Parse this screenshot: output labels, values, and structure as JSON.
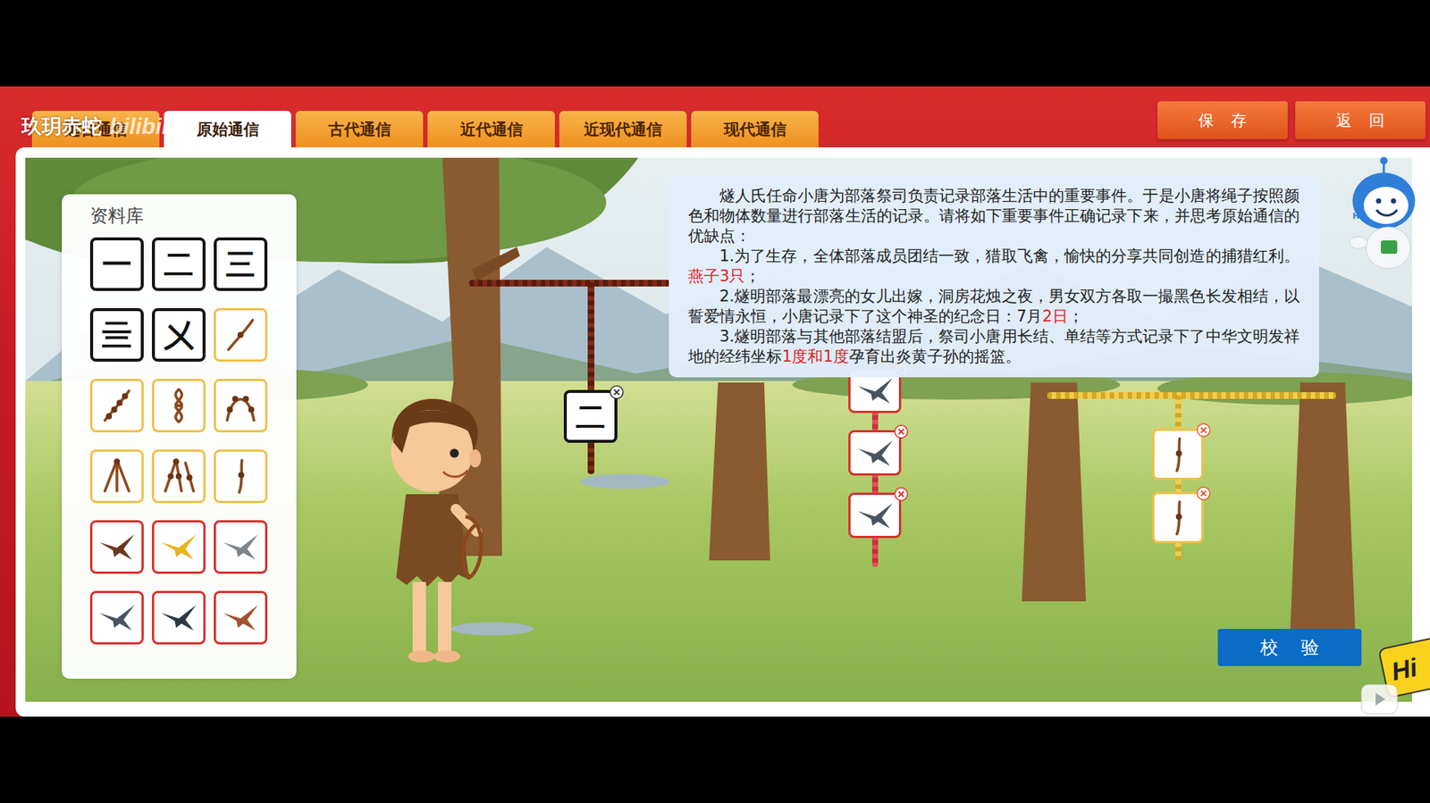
{
  "watermark": {
    "text": "玖玥赤蛇",
    "logo": "bilibili"
  },
  "tabs": [
    {
      "label": "远古通信",
      "selected": false
    },
    {
      "label": "原始通信",
      "selected": true
    },
    {
      "label": "古代通信",
      "selected": false
    },
    {
      "label": "近代通信",
      "selected": false
    },
    {
      "label": "近现代通信",
      "selected": false
    },
    {
      "label": "现代通信",
      "selected": false
    }
  ],
  "buttons": [
    "保 存",
    "返 回"
  ],
  "library": {
    "title": "资料库",
    "items": [
      {
        "kind": "tally",
        "text": "一"
      },
      {
        "kind": "tally",
        "text": "二"
      },
      {
        "kind": "tally",
        "text": "三"
      },
      {
        "kind": "tally",
        "text": "亖"
      },
      {
        "kind": "tally",
        "text": "㐅"
      },
      {
        "kind": "knot"
      },
      {
        "kind": "knot"
      },
      {
        "kind": "knot"
      },
      {
        "kind": "knot"
      },
      {
        "kind": "knot"
      },
      {
        "kind": "knot"
      },
      {
        "kind": "knot"
      },
      {
        "kind": "bird"
      },
      {
        "kind": "bird"
      },
      {
        "kind": "bird"
      },
      {
        "kind": "bird"
      },
      {
        "kind": "bird"
      },
      {
        "kind": "bird"
      }
    ]
  },
  "task": {
    "paragraphs": [
      [
        {
          "text": "燧人氏任命小唐为部落祭司负责记录部落生活中的重要事件。于是小唐将绳子按照颜色和物体数量进行部落生活的记录。请将如下重要事件正确记录下来，并思考原始通信的优缺点：",
          "highlight": false
        }
      ],
      [
        {
          "text": "1.为了生存，全体部落成员团结一致，猎取飞禽，愉快的分享共同创造的捕猎红利。",
          "highlight": false
        },
        {
          "text": "燕子3只",
          "highlight": true
        },
        {
          "text": "；",
          "highlight": false
        }
      ],
      [
        {
          "text": "2.燧明部落最漂亮的女儿出嫁，洞房花烛之夜，男女双方各取一撮黑色长发相结，以誓爱情永恒，小唐记录下了这个神圣的纪念日：7月",
          "highlight": false
        },
        {
          "text": "2日",
          "highlight": true
        },
        {
          "text": "；",
          "highlight": false
        }
      ],
      [
        {
          "text": "3.燧明部落与其他部落结盟后，祭司小唐用长结、单结等方式记录下了中华文明发祥地的经纬坐标",
          "highlight": false
        },
        {
          "text": "1度和1度",
          "highlight": true
        },
        {
          "text": "孕育出炎黄子孙的摇篮。",
          "highlight": false
        }
      ]
    ]
  },
  "placements": {
    "rope_left": [
      {
        "kind": "tally",
        "text": "二"
      }
    ],
    "rope_middle": [
      {
        "kind": "bird"
      },
      {
        "kind": "bird"
      },
      {
        "kind": "bird"
      }
    ],
    "rope_right": [
      {
        "kind": "knot"
      },
      {
        "kind": "knot"
      }
    ]
  },
  "verify_button": "校 验",
  "mascot": {
    "badge": "Hi"
  },
  "corner_badge": "Hi"
}
